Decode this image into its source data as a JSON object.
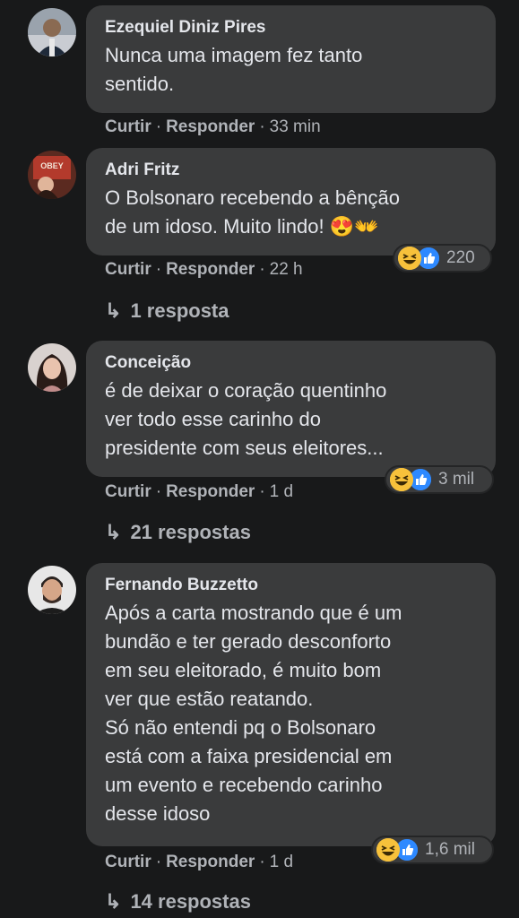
{
  "actions": {
    "like": "Curtir",
    "reply": "Responder",
    "separator": "·"
  },
  "comments": [
    {
      "author": "Ezequiel Diniz Pires",
      "text": "Nunca uma imagem fez tanto\nsentido.",
      "time": "33 min"
    },
    {
      "author": "Adri Fritz",
      "text": "O Bolsonaro recebendo a bênção\nde um idoso. Muito lindo! 😍👐",
      "time": "22 h",
      "reaction_count": "220",
      "replies": "1 resposta"
    },
    {
      "author": "Conceição",
      "text": "é de deixar o coração quentinho\nver todo esse carinho do\npresidente com seus eleitores...",
      "time": "1 d",
      "reaction_count": "3 mil",
      "replies": "21 respostas"
    },
    {
      "author": "Fernando Buzzetto",
      "text": "Após a carta mostrando que é um\nbundão e ter gerado desconforto\nem seu eleitorado, é muito bom\nver que estão reatando.\nSó não entendi pq o Bolsonaro\nestá com a faixa presidencial em\num evento e recebendo carinho\ndesse idoso",
      "time": "1 d",
      "reaction_count": "1,6 mil",
      "replies": "14 respostas"
    }
  ],
  "colors": {
    "background": "#18191a",
    "bubble": "#3a3b3c",
    "muted": "#b0b3b8",
    "text": "#e4e6eb",
    "like_blue": "#2e89ff",
    "haha_yellow": "#f7c13b"
  },
  "icons": [
    "haha-reaction-icon",
    "like-reaction-icon",
    "reply-arrow-icon",
    "avatar"
  ]
}
